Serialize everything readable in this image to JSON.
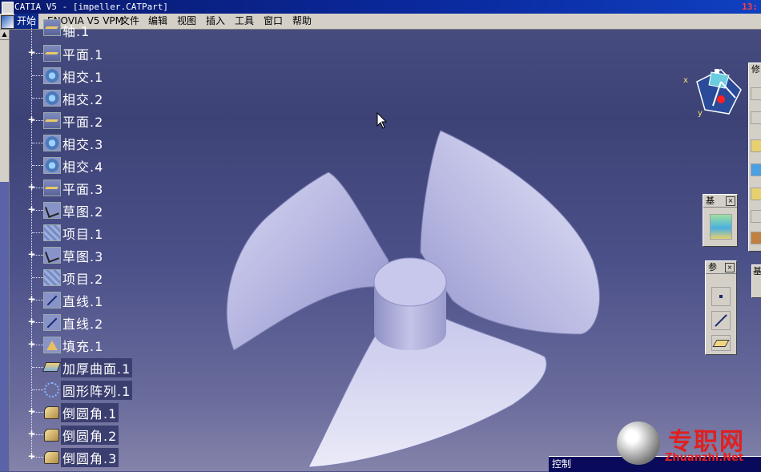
{
  "window": {
    "title": "CATIA V5 - [impeller.CATPart]",
    "clock": "13:"
  },
  "menu": {
    "items": [
      "开始",
      "ENOVIA V5 VPM",
      "文件",
      "编辑",
      "视图",
      "插入",
      "工具",
      "窗口",
      "帮助"
    ]
  },
  "tree": {
    "top_partial": "轴.1",
    "items": [
      {
        "label": "平面.1",
        "icon": "plane-icon",
        "expandable": true,
        "boxed": false
      },
      {
        "label": "相交.1",
        "icon": "intersection-icon",
        "expandable": false,
        "boxed": false
      },
      {
        "label": "相交.2",
        "icon": "intersection-icon",
        "expandable": false,
        "boxed": false
      },
      {
        "label": "平面.2",
        "icon": "plane-icon",
        "expandable": true,
        "boxed": false
      },
      {
        "label": "相交.3",
        "icon": "intersection-icon",
        "expandable": false,
        "boxed": false
      },
      {
        "label": "相交.4",
        "icon": "intersection-icon",
        "expandable": false,
        "boxed": false
      },
      {
        "label": "平面.3",
        "icon": "plane-icon",
        "expandable": true,
        "boxed": false
      },
      {
        "label": "草图.2",
        "icon": "sketch-icon",
        "expandable": true,
        "boxed": false
      },
      {
        "label": "项目.1",
        "icon": "projection-icon",
        "expandable": false,
        "boxed": false
      },
      {
        "label": "草图.3",
        "icon": "sketch-icon",
        "expandable": true,
        "boxed": false
      },
      {
        "label": "项目.2",
        "icon": "projection-icon",
        "expandable": false,
        "boxed": false
      },
      {
        "label": "直线.1",
        "icon": "line-icon",
        "expandable": true,
        "boxed": false
      },
      {
        "label": "直线.2",
        "icon": "line-icon",
        "expandable": true,
        "boxed": false
      },
      {
        "label": "填充.1",
        "icon": "fill-icon",
        "expandable": true,
        "boxed": false
      },
      {
        "label": "加厚曲面.1",
        "icon": "thick-surface-icon",
        "expandable": false,
        "boxed": true
      },
      {
        "label": "圆形阵列.1",
        "icon": "circular-pattern-icon",
        "expandable": false,
        "boxed": true
      },
      {
        "label": "倒圆角.1",
        "icon": "edge-fillet-icon",
        "expandable": true,
        "boxed": true
      },
      {
        "label": "倒圆角.2",
        "icon": "edge-fillet-icon",
        "expandable": true,
        "boxed": true
      },
      {
        "label": "倒圆角.3",
        "icon": "edge-fillet-icon",
        "expandable": true,
        "boxed": true
      }
    ]
  },
  "compass": {
    "x_label": "x",
    "y_label": "y"
  },
  "toolbars": {
    "right_partial_title": "修",
    "base_title": "基",
    "ref_title": "参",
    "right_lower_title": "基"
  },
  "bottom_panel": {
    "label": "控制"
  },
  "watermark": {
    "cn": "专职网",
    "en": "Zhuanzhi.Net"
  }
}
